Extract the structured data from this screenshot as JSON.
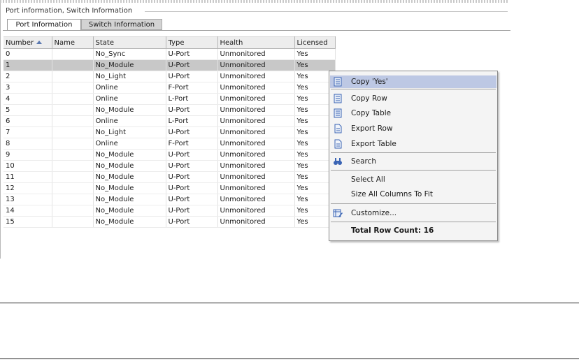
{
  "panel": {
    "title": "Port information, Switch Information",
    "tabs": [
      {
        "label": "Port Information",
        "active": true
      },
      {
        "label": "Switch Information",
        "active": false
      }
    ]
  },
  "table": {
    "columns": [
      "Number",
      "Name",
      "State",
      "Type",
      "Health",
      "Licensed"
    ],
    "sorted_column": "Number",
    "sort_icon": "sort-ascending-icon",
    "selected_row": 1,
    "rows": [
      [
        "0",
        "",
        "No_Sync",
        "U-Port",
        "Unmonitored",
        "Yes"
      ],
      [
        "1",
        "",
        "No_Module",
        "U-Port",
        "Unmonitored",
        "Yes"
      ],
      [
        "2",
        "",
        "No_Light",
        "U-Port",
        "Unmonitored",
        "Yes"
      ],
      [
        "3",
        "",
        "Online",
        "F-Port",
        "Unmonitored",
        "Yes"
      ],
      [
        "4",
        "",
        "Online",
        "L-Port",
        "Unmonitored",
        "Yes"
      ],
      [
        "5",
        "",
        "No_Module",
        "U-Port",
        "Unmonitored",
        "Yes"
      ],
      [
        "6",
        "",
        "Online",
        "L-Port",
        "Unmonitored",
        "Yes"
      ],
      [
        "7",
        "",
        "No_Light",
        "U-Port",
        "Unmonitored",
        "Yes"
      ],
      [
        "8",
        "",
        "Online",
        "F-Port",
        "Unmonitored",
        "Yes"
      ],
      [
        "9",
        "",
        "No_Module",
        "U-Port",
        "Unmonitored",
        "Yes"
      ],
      [
        "10",
        "",
        "No_Module",
        "U-Port",
        "Unmonitored",
        "Yes"
      ],
      [
        "11",
        "",
        "No_Module",
        "U-Port",
        "Unmonitored",
        "Yes"
      ],
      [
        "12",
        "",
        "No_Module",
        "U-Port",
        "Unmonitored",
        "Yes"
      ],
      [
        "13",
        "",
        "No_Module",
        "U-Port",
        "Unmonitored",
        "Yes"
      ],
      [
        "14",
        "",
        "No_Module",
        "U-Port",
        "Unmonitored",
        "Yes"
      ],
      [
        "15",
        "",
        "No_Module",
        "U-Port",
        "Unmonitored",
        "Yes"
      ]
    ]
  },
  "context_menu": {
    "copy_value": "Copy 'Yes'",
    "copy_row": "Copy Row",
    "copy_table": "Copy Table",
    "export_row": "Export Row",
    "export_table": "Export Table",
    "search": "Search",
    "select_all": "Select All",
    "size_columns": "Size All Columns To Fit",
    "customize": "Customize...",
    "total_row_count": "Total Row Count: 16"
  },
  "colors": {
    "selected_row": "#c8c8c8",
    "menu_highlight": "#bdc8e4",
    "icon_blue": "#3a64b4"
  }
}
